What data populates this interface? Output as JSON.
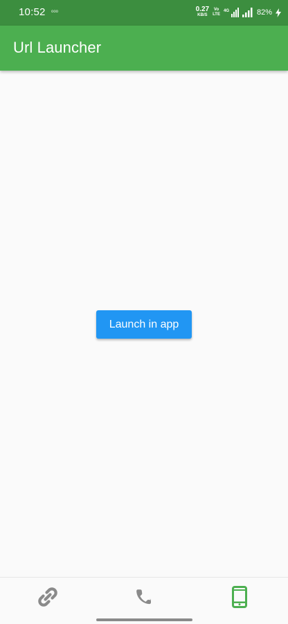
{
  "status_bar": {
    "time": "10:52",
    "notification_text": "ооо",
    "net_speed_value": "0.27",
    "net_speed_unit": "KB/S",
    "volte_top": "Vo",
    "volte_bottom": "LTE",
    "network": "4G",
    "battery": "82%"
  },
  "app_bar": {
    "title": "Url Launcher"
  },
  "main": {
    "launch_button_label": "Launch in app"
  },
  "bottom_nav": {
    "items": [
      {
        "icon": "link-icon",
        "color": "#8a8a8a",
        "selected": false
      },
      {
        "icon": "phone-icon",
        "color": "#8a8a8a",
        "selected": false
      },
      {
        "icon": "smartphone-icon",
        "color": "#4caf50",
        "selected": true
      }
    ]
  },
  "colors": {
    "status_bar": "#3c8e3f",
    "app_bar": "#4caf50",
    "button": "#2196f3",
    "background": "#fafafa",
    "inactive_icon": "#8a8a8a",
    "active_icon": "#4caf50"
  }
}
